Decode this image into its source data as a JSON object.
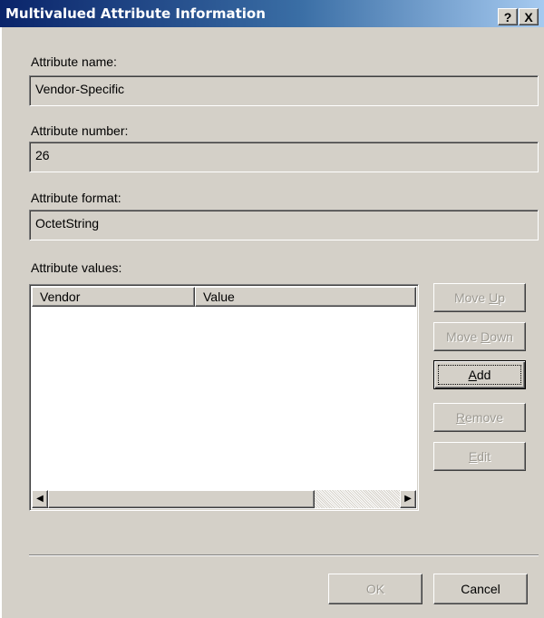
{
  "window": {
    "title": "Multivalued Attribute Information"
  },
  "title_buttons": {
    "help": "?",
    "close": "X"
  },
  "attribute_name": {
    "label": "Attribute name:",
    "value": "Vendor-Specific"
  },
  "attribute_number": {
    "label": "Attribute number:",
    "value": "26"
  },
  "attribute_format": {
    "label": "Attribute format:",
    "value": "OctetString"
  },
  "attribute_values": {
    "label": "Attribute values:",
    "columns": [
      "Vendor",
      "Value"
    ],
    "rows": []
  },
  "buttons": {
    "move_up": {
      "label_pre": "Move ",
      "label_key": "U",
      "label_post": "p"
    },
    "move_down": {
      "label_pre": "Move ",
      "label_key": "D",
      "label_post": "own"
    },
    "add": {
      "label_key": "A",
      "label_post": "dd"
    },
    "remove": {
      "label_key": "R",
      "label_post": "emove"
    },
    "edit": {
      "label_key": "E",
      "label_post": "dit"
    },
    "ok": "OK",
    "cancel": "Cancel"
  },
  "colors": {
    "dialog_bg": "#d4d0c8",
    "title_start": "#0a246a",
    "title_end": "#a6caf0"
  }
}
